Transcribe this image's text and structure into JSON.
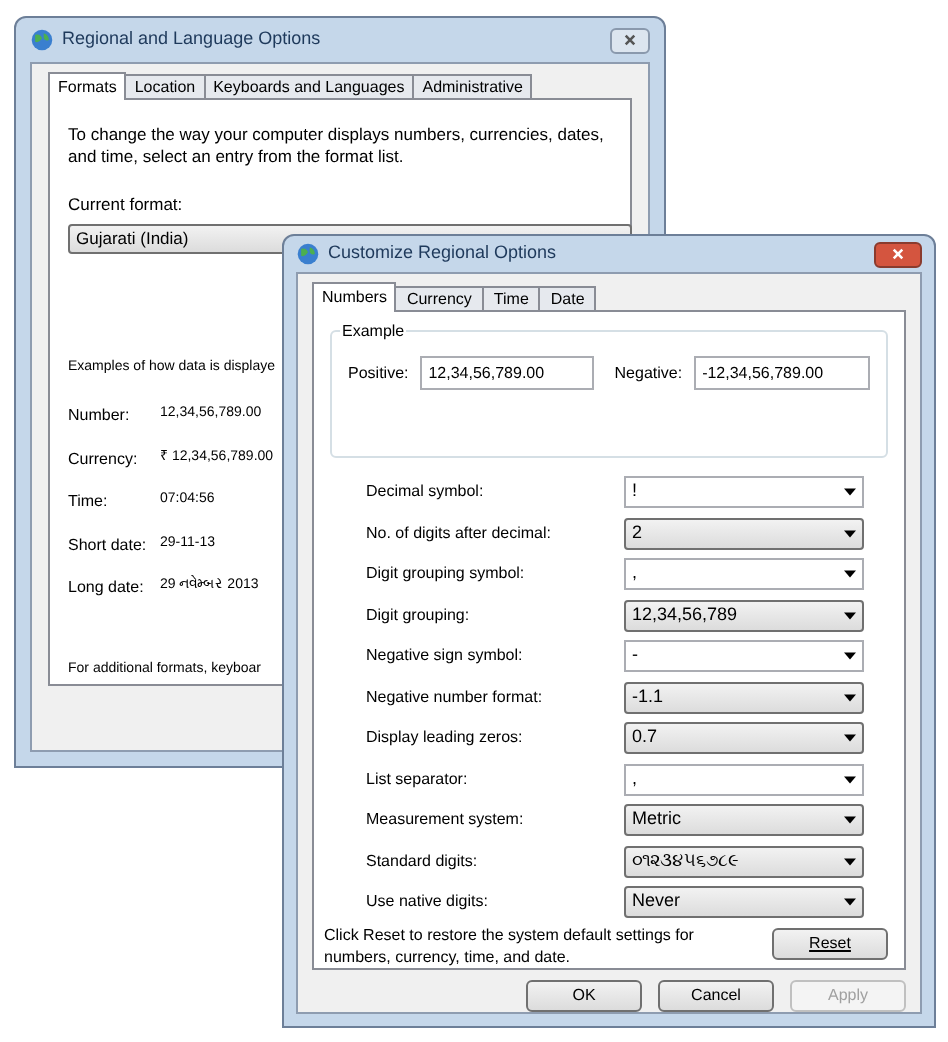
{
  "back_window": {
    "title": "Regional and Language Options",
    "tabs": [
      {
        "label": "Formats",
        "selected": true
      },
      {
        "label": "Location",
        "selected": false
      },
      {
        "label": "Keyboards and Languages",
        "selected": false
      },
      {
        "label": "Administrative",
        "selected": false
      }
    ],
    "intro": "To change the way your computer displays numbers, currencies, dates, and time, select an entry from the format list.",
    "current_format_label": "Current format:",
    "current_format": "Gujarati (India)",
    "examples_heading": "Examples of how data is displaye",
    "examples": [
      {
        "label": "Number:",
        "value": "12,34,56,789.00"
      },
      {
        "label": "Currency:",
        "value": "₹ 12,34,56,789.00"
      },
      {
        "label": "Time:",
        "value": "07:04:56"
      },
      {
        "label": "Short date:",
        "value": "29-11-13"
      },
      {
        "label": "Long date:",
        "value": "29 નવેમ્બર 2013"
      }
    ],
    "footer_text": "For additional formats, keyboar"
  },
  "dialog": {
    "title": "Customize Regional Options",
    "tabs": [
      {
        "label": "Numbers",
        "selected": true
      },
      {
        "label": "Currency",
        "selected": false
      },
      {
        "label": "Time",
        "selected": false
      },
      {
        "label": "Date",
        "selected": false
      }
    ],
    "example_group": {
      "title": "Example",
      "positive_label": "Positive:",
      "positive": "12,34,56,789.00",
      "negative_label": "Negative:",
      "negative": "-12,34,56,789.00"
    },
    "settings": [
      {
        "label": "Decimal symbol:",
        "value": "!",
        "kind": "editable"
      },
      {
        "label": "No. of digits after decimal:",
        "value": "2",
        "kind": "list"
      },
      {
        "label": "Digit grouping symbol:",
        "value": ",",
        "kind": "editable"
      },
      {
        "label": "Digit grouping:",
        "value": "12,34,56,789",
        "kind": "list"
      },
      {
        "label": "Negative sign symbol:",
        "value": "-",
        "kind": "editable"
      },
      {
        "label": "Negative number format:",
        "value": "-1.1",
        "kind": "list"
      },
      {
        "label": "Display leading zeros:",
        "value": "0.7",
        "kind": "list"
      },
      {
        "label": "List separator:",
        "value": ",",
        "kind": "editable"
      },
      {
        "label": "Measurement system:",
        "value": "Metric",
        "kind": "list"
      },
      {
        "label": "Standard digits:",
        "value": "૦૧૨૩૪૫૬૭૮૯",
        "kind": "list"
      },
      {
        "label": "Use native digits:",
        "value": "Never",
        "kind": "list"
      }
    ],
    "reset_text": "Click Reset to restore the system default settings for numbers, currency, time, and date.",
    "reset_button": "Reset",
    "buttons": [
      {
        "label": "OK",
        "disabled": false
      },
      {
        "label": "Cancel",
        "disabled": false
      },
      {
        "label": "Apply",
        "disabled": true
      }
    ]
  }
}
